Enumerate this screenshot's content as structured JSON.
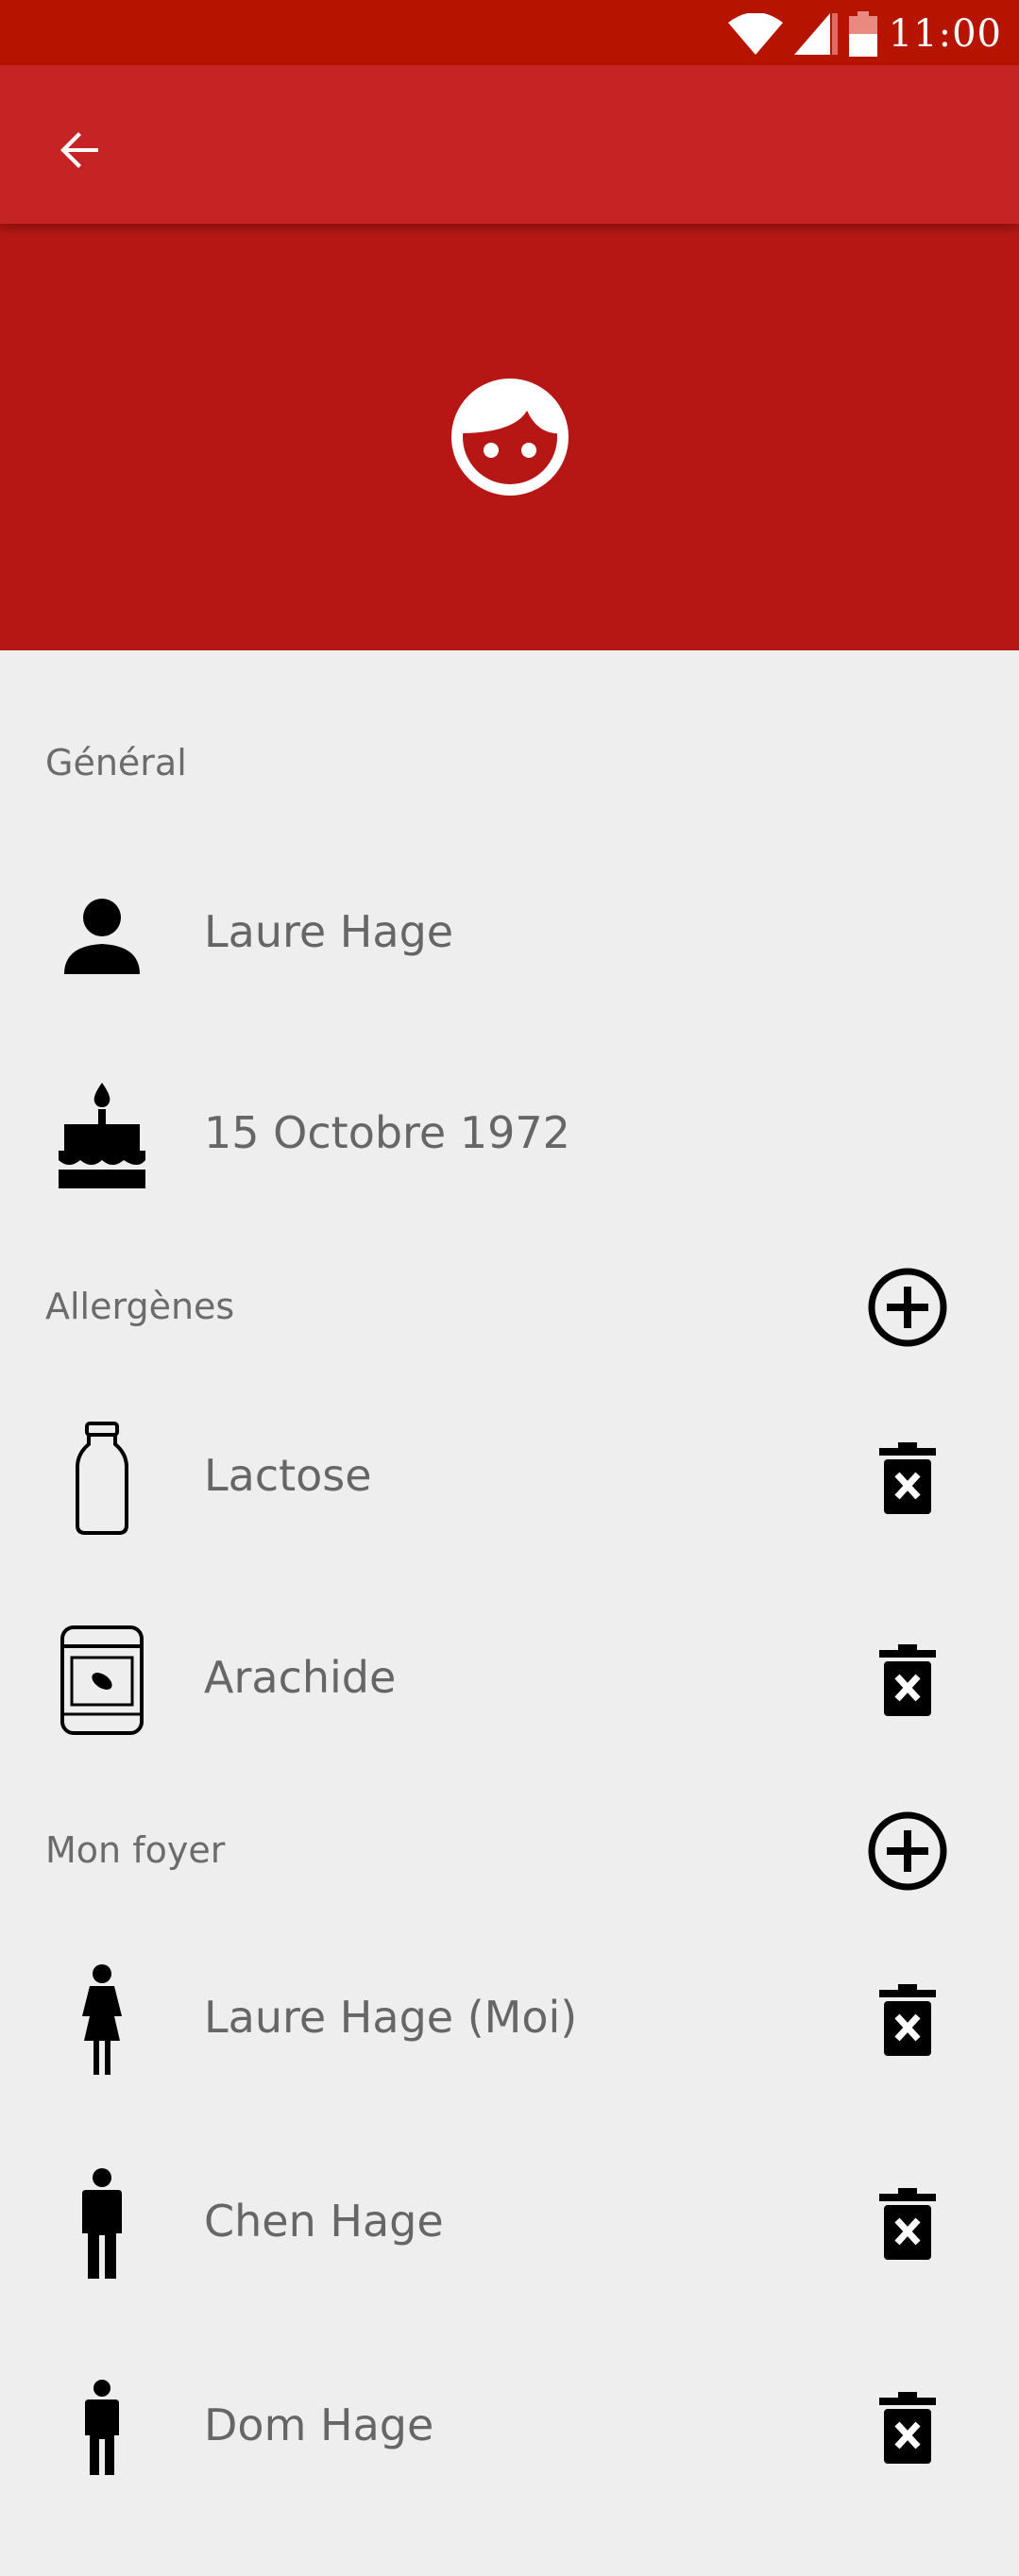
{
  "status_bar": {
    "time": "11:00"
  },
  "appbar": {
    "back_icon": "arrow-back-icon"
  },
  "profile": {
    "avatar_icon": "face-icon"
  },
  "general": {
    "header": "Général",
    "name": "Laure Hage",
    "birthdate": "15 Octobre 1972"
  },
  "allergens": {
    "header": "Allergènes",
    "items": [
      {
        "label": "Lactose",
        "icon": "milk-bottle-icon"
      },
      {
        "label": "Arachide",
        "icon": "peanut-jar-icon"
      }
    ]
  },
  "household": {
    "header": "Mon foyer",
    "members": [
      {
        "label": "Laure Hage (Moi)",
        "icon": "woman-icon"
      },
      {
        "label": "Chen Hage",
        "icon": "man-icon"
      },
      {
        "label": "Dom Hage",
        "icon": "child-icon"
      }
    ]
  },
  "colors": {
    "status_bar": "#b71400",
    "appbar": "#c62424",
    "header_banner": "#b71714",
    "background": "#eeeeee",
    "text": "#666666"
  }
}
